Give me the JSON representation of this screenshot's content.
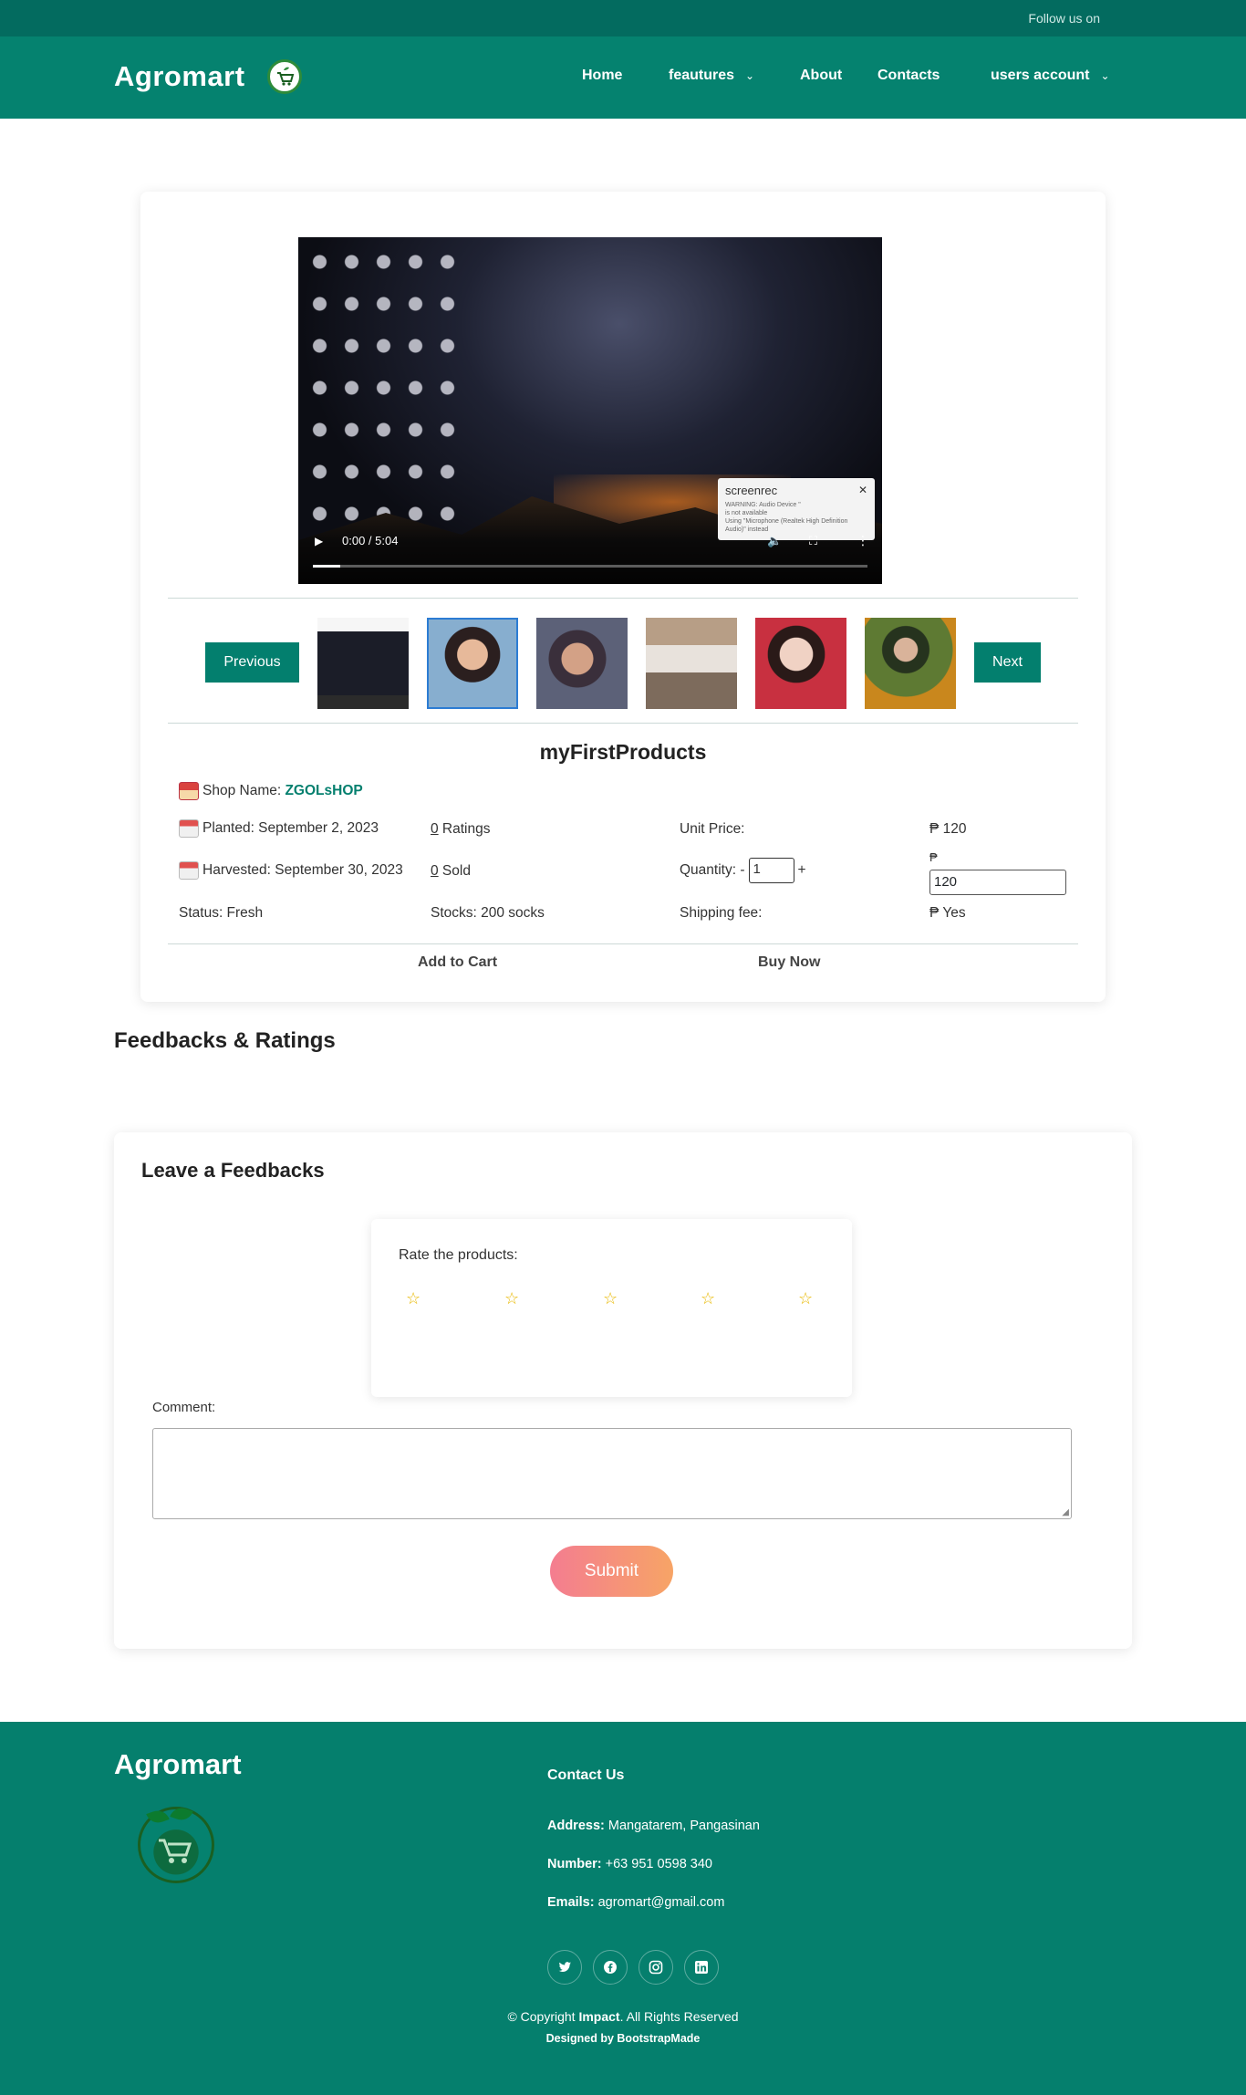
{
  "topbar": {
    "follow_text": "Follow us on",
    "social_icons": [
      "twitter-icon",
      "facebook-icon",
      "instagram-icon",
      "linkedin-icon"
    ]
  },
  "header": {
    "brand": "Agromart",
    "nav": {
      "home": "Home",
      "features": "feautures",
      "about": "About",
      "contacts": "Contacts",
      "account": "users account"
    }
  },
  "video": {
    "time": "0:00 / 5:04",
    "progress": 0.05,
    "popup_title": "screenrec",
    "popup_lines": [
      "WARNING: Audio Device \"",
      "is not available",
      "Using \"Microphone (Realtek High Definition Audio)\" instead"
    ]
  },
  "gallery": {
    "previous_label": "Previous",
    "next_label": "Next"
  },
  "product": {
    "title": "myFirstProducts",
    "shop_label": "Shop Name: ",
    "shop_name": "ZGOLsHOP",
    "planted": "Planted: September 2, 2023",
    "harvested": "Harvested: September 30, 2023",
    "status": "Status: Fresh",
    "ratings_count": "0",
    "ratings_label": " Ratings",
    "sold_count": "0",
    "sold_label": " Sold",
    "stocks": "Stocks: 200 socks",
    "unit_price_label": "Unit Price:",
    "unit_price_value": "₱ 120",
    "quantity_label": "Quantity: -",
    "quantity_value": "1",
    "quantity_plus": "+",
    "total_currency": "₱",
    "total_value": "120",
    "shipping_label": "Shipping fee:",
    "shipping_value": "₱ Yes",
    "add_to_cart": "Add to Cart",
    "buy_now": "Buy Now"
  },
  "feedback": {
    "section_title": "Feedbacks & Ratings",
    "card_title": "Leave a Feedbacks",
    "rate_label": "Rate the products:",
    "stars": 5,
    "comment_label": "Comment:",
    "submit_label": "Submit"
  },
  "footer": {
    "brand": "Agromart",
    "contact_heading": "Contact Us",
    "address_label": "Address:",
    "address_value": " Mangatarem, Pangasinan",
    "number_label": "Number:",
    "number_value": " +63 951 0598 340",
    "emails_label": "Emails:",
    "emails_value": " agromart@gmail.com",
    "copyright_pre": "© Copyright ",
    "copyright_brand": "Impact",
    "copyright_post": ". All Rights Reserved",
    "designed_pre": "Designed by ",
    "designed_brand": "BootstrapMade"
  },
  "colors": {
    "primary": "#05826f",
    "topbar": "#036b5f",
    "button": "#037f6e",
    "submit_start": "#f47d90",
    "submit_end": "#f7a466",
    "star": "#e8b800"
  }
}
